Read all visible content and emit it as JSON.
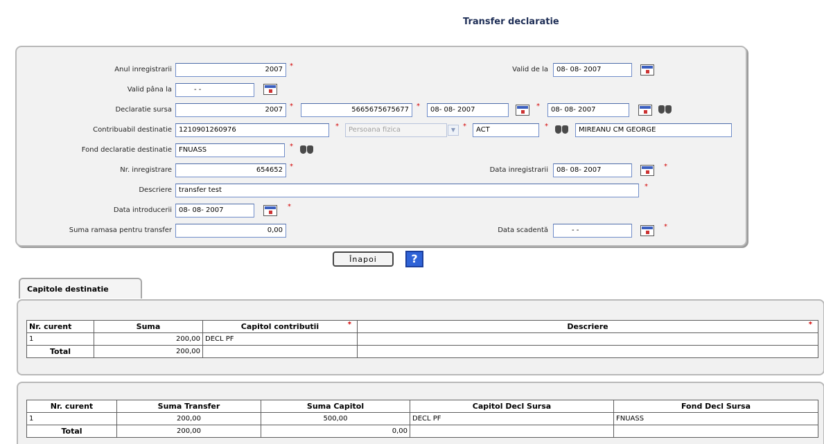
{
  "page": {
    "title": "Transfer declaratie"
  },
  "form": {
    "anul_label": "Anul inregistrarii",
    "anul_value": "2007",
    "valid_de_la_label": "Valid de la",
    "valid_de_la_value": "08- 08-  2007",
    "valid_pana_label": "Valid pâna la",
    "valid_pana_value": "-   -",
    "decl_sursa_label": "Declaratie sursa",
    "decl_sursa_year": "2007",
    "decl_sursa_nr": "5665675675677",
    "decl_sursa_date1": "08- 08-  2007",
    "decl_sursa_date2": "08- 08-  2007",
    "contrib_label": "Contribuabil destinatie",
    "contrib_value": "1210901260976",
    "contrib_type": "Persoana fizica",
    "contrib_code": "ACT",
    "contrib_name": "MIREANU CM GEORGE",
    "fond_label": "Fond declaratie destinatie",
    "fond_value": "FNUASS",
    "nr_inreg_label": "Nr. inregistrare",
    "nr_inreg_value": "654652",
    "data_inreg_label": "Data inregistrarii",
    "data_inreg_value": "08- 08-  2007",
    "descriere_label": "Descriere",
    "descriere_value": "transfer test",
    "data_intro_label": "Data introducerii",
    "data_intro_value": "08- 08-  2007",
    "suma_label": "Suma ramasa pentru transfer",
    "suma_value": "0,00",
    "data_scad_label": "Data scadentă",
    "data_scad_value": "-   -",
    "required_mark": "*"
  },
  "buttons": {
    "inapoi": "Înapoi",
    "help": "?"
  },
  "tab": {
    "label": "Capitole destinatie"
  },
  "table1": {
    "headers": [
      "Nr. curent",
      "Suma",
      "Capitol contributii",
      "Descriere"
    ],
    "row": [
      "1",
      "200,00",
      "DECL PF",
      ""
    ],
    "total": [
      "Total",
      "200,00",
      "",
      ""
    ]
  },
  "table2": {
    "headers": [
      "Nr. curent",
      "Suma Transfer",
      "Suma Capitol",
      "Capitol Decl Sursa",
      "Fond Decl Sursa"
    ],
    "row": [
      "1",
      "200,00",
      "500,00",
      "DECL PF",
      "FNUASS"
    ],
    "total": [
      "Total",
      "200,00",
      "0,00",
      "",
      ""
    ]
  },
  "icons": {
    "calendar": "calendar-icon",
    "search": "binoculars-icon",
    "help": "help-icon"
  },
  "colors": {
    "title": "#1f2f57",
    "required": "#d40000",
    "help_bg": "#2f63d7",
    "input_border": "#6f8cc9"
  }
}
